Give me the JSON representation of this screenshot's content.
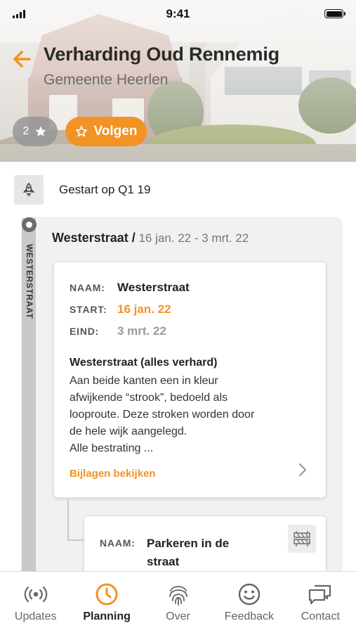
{
  "status_bar": {
    "time": "9:41"
  },
  "header": {
    "title": "Verharding Oud Rennemig",
    "subtitle": "Gemeente Heerlen",
    "star_count": "2",
    "follow_label": "Volgen"
  },
  "started": {
    "label": "Gestart op Q1 19"
  },
  "timeline": {
    "rail_label": "WESTERSTRAAT",
    "section_title": "Westerstraat /",
    "section_dates": " 16 jan. 22 - 3 mrt. 22",
    "card": {
      "name_key": "NAAM:",
      "name_value": "Westerstraat",
      "start_key": "START:",
      "start_value": "16 jan. 22",
      "end_key": "EIND:",
      "end_value": "3 mrt. 22",
      "desc_title": "Westerstraat (alles verhard)",
      "desc_lines": [
        "Aan beide kanten een in kleur",
        "afwijkende “strook”, bedoeld als",
        "looproute. Deze stroken worden door",
        "de hele wijk aangelegd.",
        "Alle bestrating ..."
      ],
      "attachments_link": "Bijlagen bekijken"
    },
    "card2": {
      "name_key": "NAAM:",
      "name_value_lines": [
        "Parkeren in de",
        "straat"
      ]
    }
  },
  "tabbar": {
    "tabs": [
      {
        "label": "Updates",
        "icon": "broadcast-icon"
      },
      {
        "label": "Planning",
        "icon": "clock-icon",
        "active": true
      },
      {
        "label": "Over",
        "icon": "fingerprint-icon"
      },
      {
        "label": "Feedback",
        "icon": "smiley-icon"
      },
      {
        "label": "Contact",
        "icon": "chat-icon"
      }
    ]
  },
  "colors": {
    "accent": "#f39324",
    "muted": "#9a9a9a",
    "rail": "#c8c8c8"
  }
}
